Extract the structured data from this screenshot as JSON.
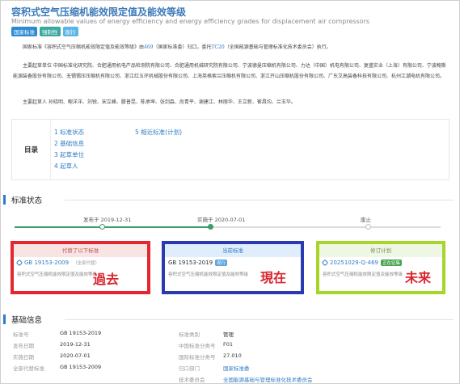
{
  "header": {
    "title": "容积式空气压缩机能效限定值及能效等级",
    "subtitle": "Minimum allowable values of energy efficiency and energy efficiency grades for displacement air compressors",
    "tags": [
      "国家标准",
      "强制性",
      "现行"
    ]
  },
  "intro": {
    "p1_pre": "国家标准《容积式空气压缩机能效限定值及能效等级》由",
    "p1_link1": "469",
    "p1_mid": "（国家标准委）归口，委托",
    "p1_link2": "TC20",
    "p1_post": "（全国能源基础与管理标准化技术委员会）执行。",
    "p2": "主要起草单位 中国标准化研究院、合肥通用机电产品检测院有限公司、合肥通用机械研究院有限公司、宁波德曼压缩机有限公司、力达（中国）机电有限公司、复盛实业（上海）有限公司、宁波鲍斯能源装备股份有限公司、无锡锡压压缩机有限公司、浙江红五环机械股份有限公司、上海英格索兰压缩机有限公司、浙江开山压缩机股份有限公司、广东艾高装备科技有限公司、杭州江潮电机有限公司。",
    "p3": "主要起草人 孙晓明、鲍洋洋、刘锐、宋立峰、滕普昆、陈承坤、张剑森、尚青平、谢建江、林丽华、王立新、崔昌均、兰玉华。"
  },
  "toc": {
    "heading": "目录",
    "col1": [
      "1  标准状态",
      "2  基础信息",
      "3  起草单位",
      "4  起草人"
    ],
    "col2": [
      "5  相近标准(计划)"
    ]
  },
  "status": {
    "section_title": "标准状态",
    "timeline": {
      "published": "发布于 2019-12-31",
      "effective": "实施于 2020-07-01",
      "abolished": "废止"
    },
    "cards": {
      "past": {
        "head": "代替了以下标准",
        "code": "GB 19153-2009",
        "badge": "（全部代替）",
        "desc": "容积式空气压缩机能效限定值及能效等级",
        "overlay": "過去"
      },
      "now": {
        "head": "当前标准",
        "code": "GB 19153-2019",
        "badge": "现行",
        "desc": "容积式空气压缩机能效限定值及能效等级",
        "overlay": "現在"
      },
      "future": {
        "head": "修订计划",
        "code": "20251029-Q-469",
        "badge": "正在征集",
        "desc": "容积式空气压缩机能效限定值及能效等级",
        "overlay": "未来"
      }
    }
  },
  "basic": {
    "section_title": "基础信息",
    "rows": [
      {
        "k1": "标准号",
        "v1": "GB 19153-2019",
        "k2": "标准类别",
        "v2": "管理"
      },
      {
        "k1": "发布日期",
        "v1": "2019-12-31",
        "k2": "中国标准分类号",
        "v2": "F01"
      },
      {
        "k1": "实施日期",
        "v1": "2020-07-01",
        "k2": "国际标准分类号",
        "v2": "27.010"
      },
      {
        "k1": "全部代替标准",
        "v1": "GB 19153-2009",
        "k2": "归口部门",
        "v2": "国家标准委"
      },
      {
        "k1": "",
        "v1": "",
        "k2": "技术委员会",
        "v2": "全国能源基础与管理标准化技术委员会"
      }
    ]
  },
  "colors": {
    "accent": "#2f7cc5",
    "past_border": "#e3262f",
    "now_border": "#2b3ab0",
    "future_border": "#a7d62b",
    "overlay_text": "#d9262e"
  }
}
